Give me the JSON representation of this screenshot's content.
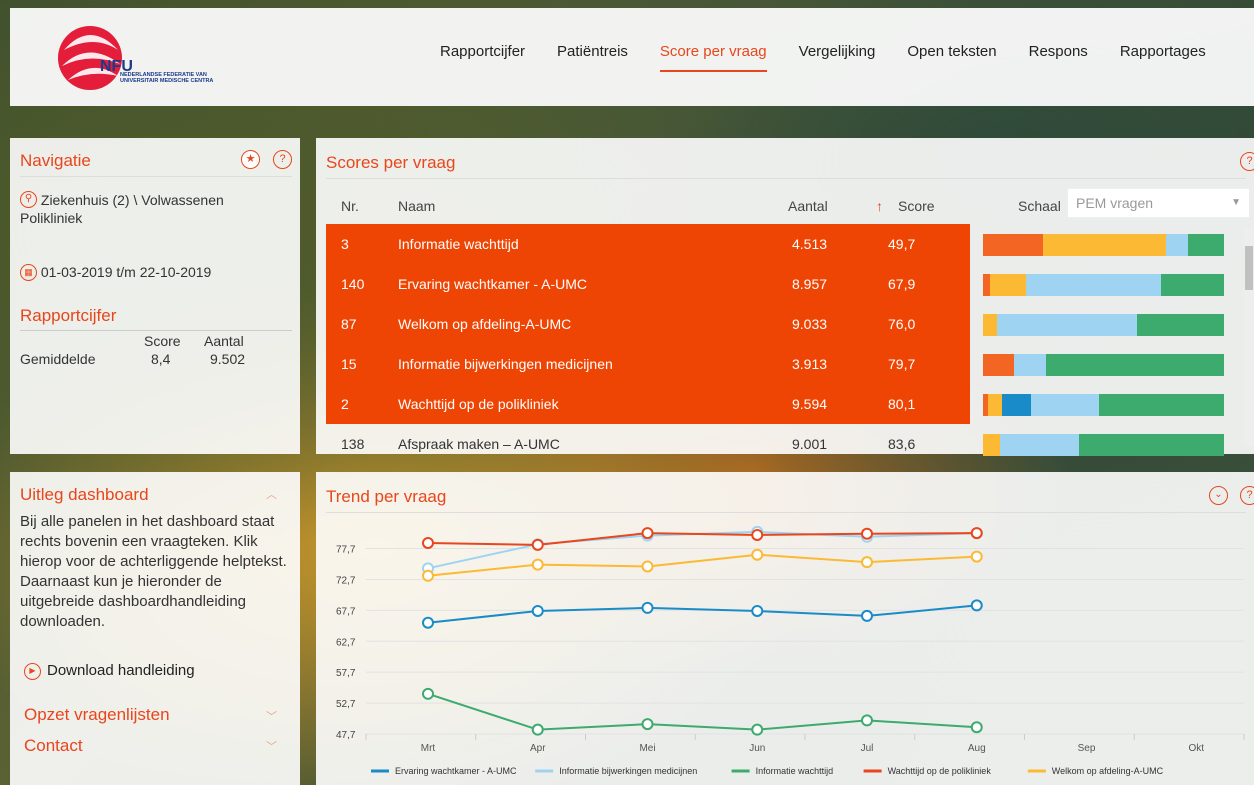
{
  "brand": {
    "logo_text": "NFU",
    "logo_sub": "NEDERLANDSE FEDERATIE VAN UNIVERSITAIR MEDISCHE CENTRA"
  },
  "nav": [
    "Rapportcijfer",
    "Patiëntreis",
    "Score per vraag",
    "Vergelijking",
    "Open teksten",
    "Respons",
    "Rapportages"
  ],
  "nav_active": "Score per vraag",
  "navigatie": {
    "title": "Navigatie",
    "path": "Ziekenhuis (2) \\ Volwassenen Polikliniek",
    "date": "01-03-2019 t/m 22-10-2019"
  },
  "rapportcijfer": {
    "title": "Rapportcijfer",
    "col_score": "Score",
    "col_aantal": "Aantal",
    "label": "Gemiddelde",
    "score": "8,4",
    "aantal": "9.502"
  },
  "uitleg": {
    "title": "Uitleg dashboard",
    "text": "Bij alle panelen in het dashboard staat rechts bovenin een vraagteken. Klik hierop voor de achterliggende helptekst. Daarnaast kun je hieronder de uitgebreide dashboardhandleiding downloaden.",
    "download": "Download handleiding",
    "acc1": "Opzet vragenlijsten",
    "acc2": "Contact"
  },
  "scores": {
    "title": "Scores per vraag",
    "headers": {
      "nr": "Nr.",
      "naam": "Naam",
      "aantal": "Aantal",
      "score": "Score",
      "sort_icon": "↑",
      "schaal": "Schaal"
    },
    "schaal_value": "PEM vragen",
    "rows": [
      {
        "nr": "3",
        "naam": "Informatie wachttijd",
        "aantal": "4.513",
        "score": "49,7",
        "hl": true
      },
      {
        "nr": "140",
        "naam": "Ervaring wachtkamer - A-UMC",
        "aantal": "8.957",
        "score": "67,9",
        "hl": true
      },
      {
        "nr": "87",
        "naam": "Welkom op afdeling-A-UMC",
        "aantal": "9.033",
        "score": "76,0",
        "hl": true
      },
      {
        "nr": "15",
        "naam": "Informatie bijwerkingen medicijnen",
        "aantal": "3.913",
        "score": "79,7",
        "hl": true
      },
      {
        "nr": "2",
        "naam": "Wachttijd op de polikliniek",
        "aantal": "9.594",
        "score": "80,1",
        "hl": true
      },
      {
        "nr": "138",
        "naam": "Afspraak maken – A-UMC",
        "aantal": "9.001",
        "score": "83,6",
        "hl": false
      }
    ],
    "distribution_colors": [
      "#f26522",
      "#fbb934",
      "#1a8bc9",
      "#9fd3f2",
      "#3daa6e"
    ],
    "distributions": [
      [
        0.25,
        0.51,
        0,
        0.09,
        0.15
      ],
      [
        0.03,
        0.15,
        0,
        0.56,
        0.26
      ],
      [
        0,
        0.06,
        0,
        0.58,
        0.36
      ],
      [
        0.13,
        0,
        0,
        0.13,
        0.74
      ],
      [
        0.02,
        0.06,
        0.12,
        0.28,
        0.52
      ],
      [
        0,
        0.07,
        0,
        0.33,
        0.6
      ]
    ]
  },
  "trend": {
    "title": "Trend per vraag"
  },
  "chart_data": {
    "type": "line",
    "categories": [
      "Mrt",
      "Apr",
      "Mei",
      "Jun",
      "Jul",
      "Aug",
      "Sep",
      "Okt"
    ],
    "yticks": [
      "77,7",
      "72,7",
      "67,7",
      "62,7",
      "57,7",
      "52,7",
      "47,7"
    ],
    "ylim": [
      47.7,
      80.7
    ],
    "series": [
      {
        "name": "Ervaring wachtkamer - A-UMC",
        "color": "#1a8bc9",
        "values": [
          65.7,
          67.6,
          68.1,
          67.6,
          66.8,
          68.5
        ]
      },
      {
        "name": "Informatie bijwerkingen medicijnen",
        "color": "#9fd3f2",
        "values": [
          74.5,
          78.4,
          79.8,
          80.4,
          79.6,
          80.2
        ]
      },
      {
        "name": "Informatie wachttijd",
        "color": "#3daa6e",
        "values": [
          54.2,
          48.4,
          49.3,
          48.4,
          49.9,
          48.8
        ]
      },
      {
        "name": "Wachttijd op de polikliniek",
        "color": "#e8461c",
        "values": [
          78.6,
          78.3,
          80.2,
          79.9,
          80.1,
          80.2
        ]
      },
      {
        "name": "Welkom op afdeling-A-UMC",
        "color": "#fbb934",
        "values": [
          73.3,
          75.1,
          74.8,
          76.7,
          75.5,
          76.4
        ]
      }
    ]
  }
}
